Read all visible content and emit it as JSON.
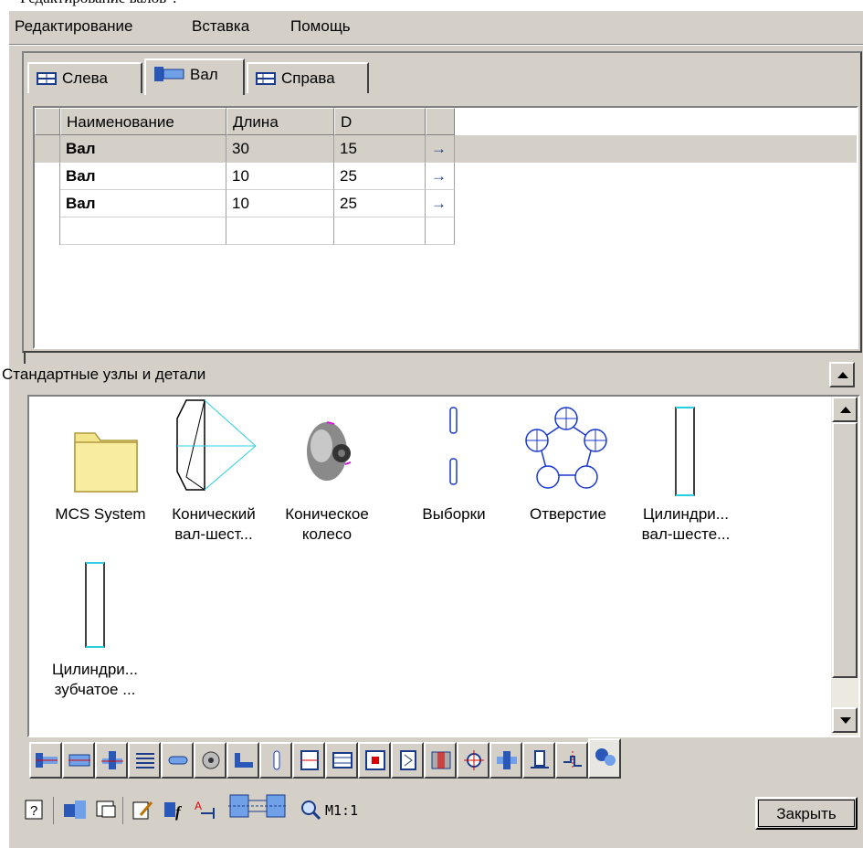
{
  "caption": "Редактирование валов\".",
  "menu": [
    "Редактирование",
    "Вставка",
    "Помощь"
  ],
  "tabs": [
    {
      "label": "Слева",
      "icon": "left-shaft-icon"
    },
    {
      "label": "Вал",
      "icon": "shaft-icon",
      "active": true
    },
    {
      "label": "Справа",
      "icon": "right-shaft-icon"
    }
  ],
  "grid": {
    "columns": [
      "Наименование",
      "Длина",
      "D"
    ],
    "rows": [
      {
        "name": "Вал",
        "length": "30",
        "d": "15",
        "arrow": "→",
        "selected": true
      },
      {
        "name": "Вал",
        "length": "10",
        "d": "25",
        "arrow": "→"
      },
      {
        "name": "Вал",
        "length": "10",
        "d": "25",
        "arrow": "→"
      }
    ]
  },
  "library": {
    "title": "Стандартные узлы и детали",
    "items": [
      {
        "line1": "MCS System",
        "line2": "",
        "icon": "folder-icon"
      },
      {
        "line1": "Конический",
        "line2": "вал-шест...",
        "icon": "bevel-shaft-gear-icon"
      },
      {
        "line1": "Коническое",
        "line2": "колесо",
        "icon": "bevel-wheel-icon"
      },
      {
        "line1": "Выборки",
        "line2": "",
        "icon": "cutouts-icon"
      },
      {
        "line1": "Отверстие",
        "line2": "",
        "icon": "holes-icon"
      },
      {
        "line1": "Цилиндри...",
        "line2": "вал-шесте...",
        "icon": "cylindrical-shaft-gear-icon"
      },
      {
        "line1": "Цилиндри...",
        "line2": "зубчатое ...",
        "icon": "cylindrical-gear-icon"
      }
    ]
  },
  "bottom": {
    "scale": "M1:1",
    "close": "Закрыть"
  }
}
